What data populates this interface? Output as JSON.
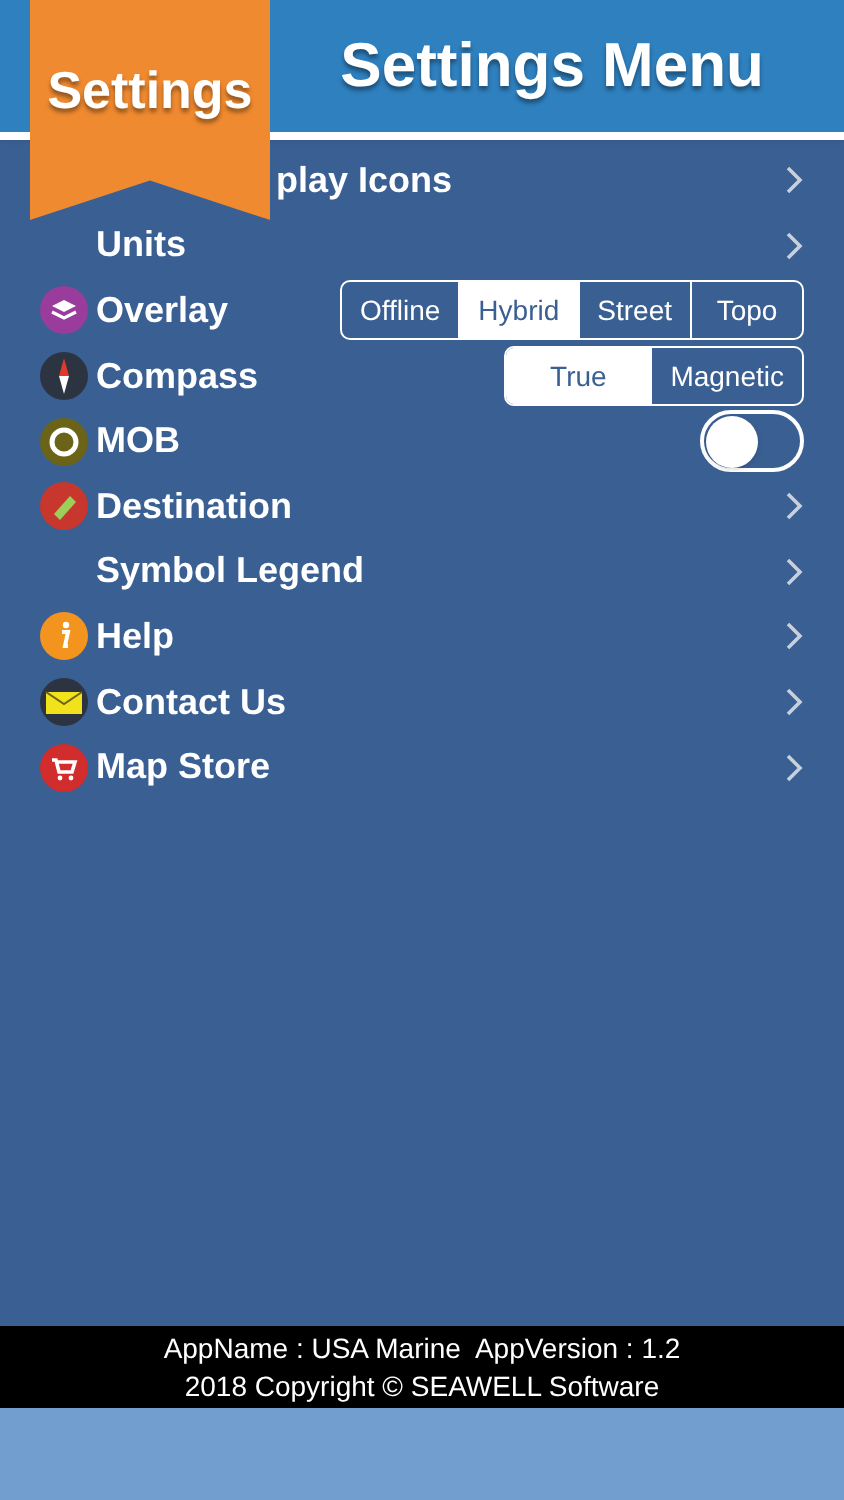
{
  "header": {
    "title": "Settings Menu"
  },
  "ribbon": {
    "label": "Settings"
  },
  "rows": [
    {
      "kind": "link",
      "label": "play Icons"
    },
    {
      "kind": "link",
      "label": "Units"
    },
    {
      "kind": "segmented",
      "label": "Overlay",
      "options": [
        {
          "label": "Offline",
          "selected": false
        },
        {
          "label": "Hybrid",
          "selected": true
        },
        {
          "label": "Street",
          "selected": false
        },
        {
          "label": "Topo",
          "selected": false
        }
      ]
    },
    {
      "kind": "segmented",
      "label": "Compass",
      "options": [
        {
          "label": "True",
          "selected": true
        },
        {
          "label": "Magnetic",
          "selected": false
        }
      ]
    },
    {
      "kind": "toggle",
      "label": "MOB",
      "on": false
    },
    {
      "kind": "link",
      "label": "Destination"
    },
    {
      "kind": "link",
      "label": "Symbol Legend"
    },
    {
      "kind": "link",
      "label": "Help"
    },
    {
      "kind": "link",
      "label": "Contact Us"
    },
    {
      "kind": "link",
      "label": "Map Store"
    }
  ],
  "footer": {
    "lines": [
      "AppName : USA Marine  AppVersion : 1.2",
      "2018 Copyright © SEAWELL Software"
    ]
  }
}
